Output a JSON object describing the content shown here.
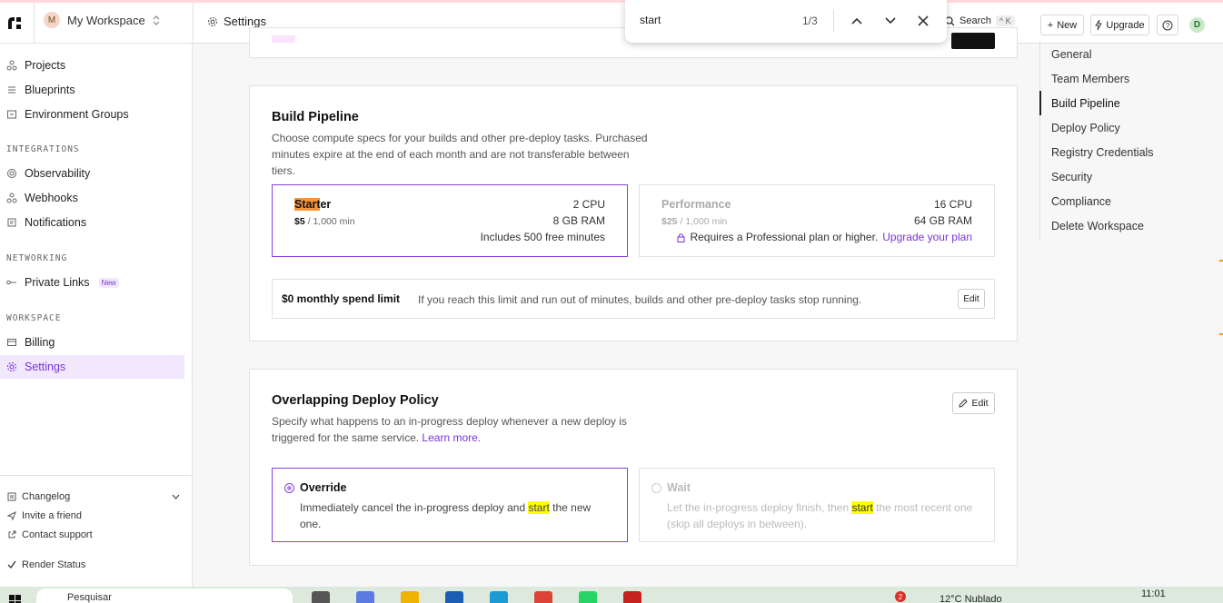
{
  "topbar": {
    "workspace_initial": "M",
    "workspace_name": "My Workspace",
    "breadcrumb": "Settings",
    "search_label": "Search",
    "search_shortcut": "^ K",
    "new_label": "New",
    "upgrade_label": "Upgrade",
    "user_initial": "D"
  },
  "findbar": {
    "query": "start",
    "count": "1/3"
  },
  "sidebar": {
    "items": [
      {
        "label": "Projects",
        "icon": "projects-icon"
      },
      {
        "label": "Blueprints",
        "icon": "blueprints-icon"
      },
      {
        "label": "Environment Groups",
        "icon": "environment-groups-icon"
      }
    ],
    "integrations_heading": "INTEGRATIONS",
    "integrations": [
      {
        "label": "Observability",
        "icon": "observability-icon"
      },
      {
        "label": "Webhooks",
        "icon": "webhooks-icon"
      },
      {
        "label": "Notifications",
        "icon": "notifications-icon"
      }
    ],
    "networking_heading": "NETWORKING",
    "networking": [
      {
        "label": "Private Links",
        "badge": "New",
        "icon": "private-links-icon"
      }
    ],
    "workspace_heading": "WORKSPACE",
    "workspace": [
      {
        "label": "Billing",
        "icon": "billing-icon"
      },
      {
        "label": "Settings",
        "icon": "settings-icon"
      }
    ],
    "footer": {
      "changelog": "Changelog",
      "invite": "Invite a friend",
      "support": "Contact support",
      "status": "Render Status"
    }
  },
  "right_nav": {
    "items": [
      "General",
      "Team Members",
      "Build Pipeline",
      "Deploy Policy",
      "Registry Credentials",
      "Security",
      "Compliance",
      "Delete Workspace"
    ],
    "active": "Build Pipeline"
  },
  "build_pipeline": {
    "title": "Build Pipeline",
    "description": "Choose compute specs for your builds and other pre-deploy tasks. Purchased minutes expire at the end of each month and are not transferable between tiers.",
    "starter": {
      "name_highlight": "Start",
      "name_rest": "er",
      "price": "$5",
      "price_unit": " / 1,000 min",
      "cpu": "2 CPU",
      "ram": "8 GB RAM",
      "free": "Includes 500 free minutes"
    },
    "performance": {
      "name": "Performance",
      "price": "$25",
      "price_unit": " / 1,000 min",
      "cpu": "16 CPU",
      "ram": "64 GB RAM",
      "requirement": "Requires a Professional plan or higher.",
      "upgrade_link": "Upgrade your plan"
    },
    "spend_limit": {
      "label": "$0 monthly spend limit",
      "text": "If you reach this limit and run out of minutes, builds and other pre-deploy tasks stop running.",
      "edit": "Edit"
    }
  },
  "deploy_policy": {
    "title": "Overlapping Deploy Policy",
    "description": "Specify what happens to an in-progress deploy whenever a new deploy is triggered for the same service.",
    "learn_more": "Learn more.",
    "edit": "Edit",
    "override": {
      "title": "Override",
      "desc_before": "Immediately cancel the in-progress deploy and ",
      "desc_highlight": "start",
      "desc_after": " the new one."
    },
    "wait": {
      "title": "Wait",
      "desc_before": "Let the in-progress deploy finish, then ",
      "desc_highlight": "start",
      "desc_after": " the most recent one (skip all deploys in between)."
    }
  },
  "taskbar": {
    "search_placeholder": "Pesquisar",
    "weather": "12°C  Nublado",
    "time": "11:01",
    "notif_count": "2"
  }
}
